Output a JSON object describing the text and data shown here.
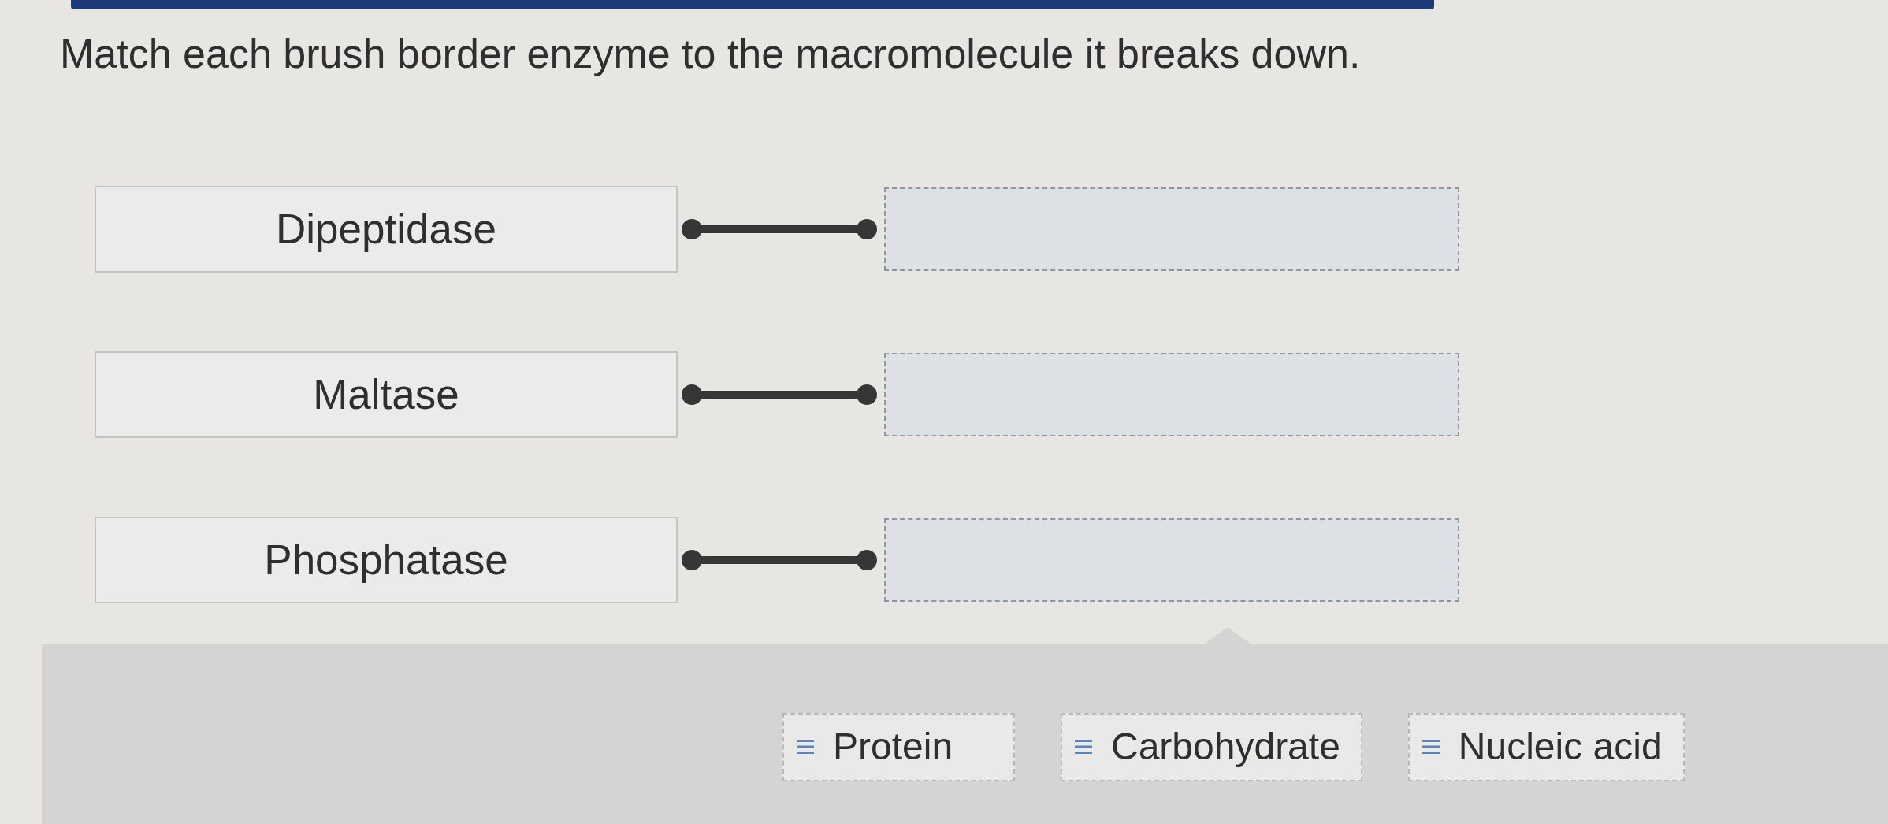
{
  "prompt": "Match each brush border enzyme to the macromolecule it breaks down.",
  "pairs": [
    {
      "enzyme": "Dipeptidase"
    },
    {
      "enzyme": "Maltase"
    },
    {
      "enzyme": "Phosphatase"
    }
  ],
  "answer_bank": [
    {
      "label": "Protein"
    },
    {
      "label": "Carbohydrate"
    },
    {
      "label": "Nucleic acid"
    }
  ]
}
